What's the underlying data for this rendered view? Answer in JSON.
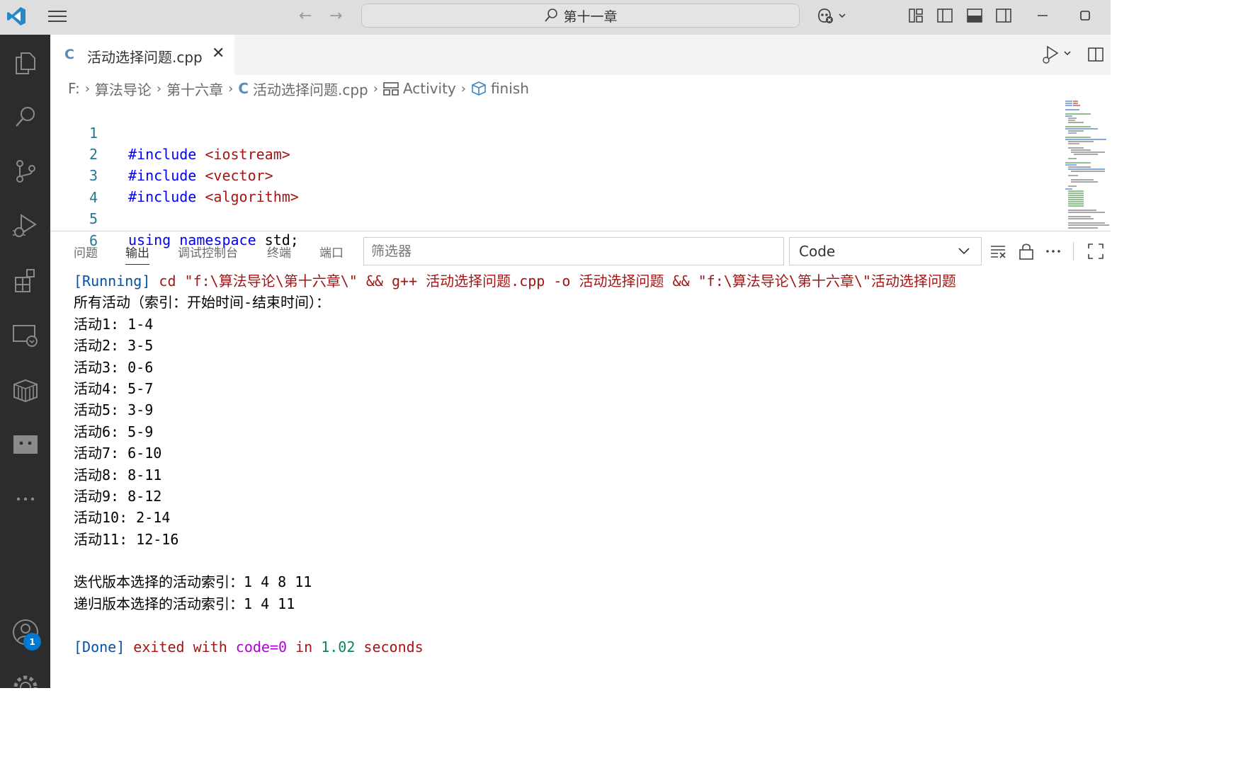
{
  "titlebar": {
    "search_text": "第十一章"
  },
  "editor_tab": {
    "label": "活动选择问题.cpp",
    "icon": "C"
  },
  "breadcrumb": [
    "F:",
    "算法导论",
    "第十六章",
    "活动选择问题.cpp",
    "Activity",
    "finish"
  ],
  "code_lines": [
    {
      "n": "1",
      "kw": "#include",
      "rest": " <iostream>"
    },
    {
      "n": "2",
      "kw": "#include",
      "rest": " <vector>"
    },
    {
      "n": "3",
      "kw": "#include",
      "rest": " <algorithm>"
    },
    {
      "n": "4",
      "kw": "",
      "rest": ""
    },
    {
      "n": "5",
      "kw": "using namespace",
      "rest": " std;"
    },
    {
      "n": "6",
      "kw": "",
      "rest": ""
    }
  ],
  "panel": {
    "tabs": [
      "问题",
      "输出",
      "调试控制台",
      "终端",
      "端口"
    ],
    "active_tab": "输出",
    "filter_placeholder": "筛选器",
    "channel": "Code"
  },
  "output": {
    "running_tag": "[Running]",
    "running_cmd": " cd \"f:\\算法导论\\第十六章\\\" && g++ 活动选择问题.cpp -o 活动选择问题 && \"f:\\算法导论\\第十六章\\\"活动选择问题",
    "lines": [
      "所有活动（索引：开始时间-结束时间）：",
      "活动1: 1-4",
      "活动2: 3-5",
      "活动3: 0-6",
      "活动4: 5-7",
      "活动5: 3-9",
      "活动6: 5-9",
      "活动7: 6-10",
      "活动8: 8-11",
      "活动9: 8-12",
      "活动10: 2-14",
      "活动11: 12-16",
      "",
      "迭代版本选择的活动索引：1 4 8 11",
      "递归版本选择的活动索引：1 4 11",
      ""
    ],
    "done_tag": "[Done]",
    "done_exited": " exited with ",
    "done_code": "code=0",
    "done_in": " in ",
    "done_time": "1.02",
    "done_seconds": " seconds"
  },
  "accounts_badge": "1",
  "colors": {
    "accent": "#0078d4",
    "activity_bar": "#2c2c2c",
    "titlebar": "#dedede"
  }
}
